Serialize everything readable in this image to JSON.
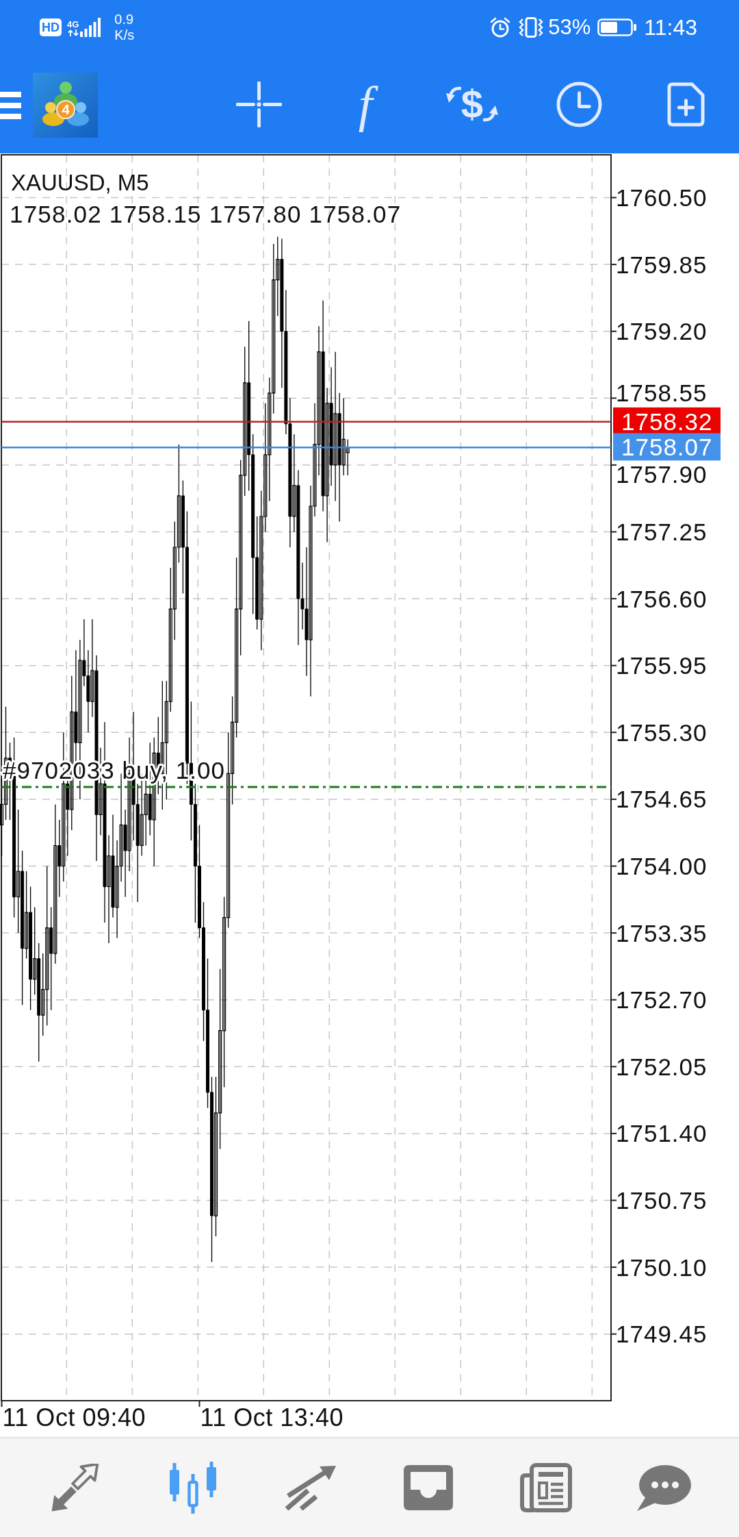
{
  "status_bar": {
    "network_badge": "HD",
    "network_type": "4G",
    "speed": "0.9",
    "speed_unit": "K/s",
    "battery": "53%",
    "time": "11:43"
  },
  "toolbar": {
    "logo_badge": "4",
    "buttons": [
      {
        "kind": "crosshair"
      },
      {
        "kind": "glyph",
        "text": "f"
      },
      {
        "kind": "money",
        "text": "$"
      },
      {
        "kind": "clock"
      },
      {
        "kind": "new-document"
      }
    ]
  },
  "chart": {
    "symbol": "XAUUSD, M5",
    "ohlc": "1758.02 1758.15 1757.80 1758.07",
    "order_label": "#9702033 buy, 1.00",
    "ask": "1758.32",
    "bid": "1758.07",
    "price_ticks": [
      "1760.50",
      "1759.85",
      "1759.20",
      "1758.55",
      "1757.90",
      "1757.25",
      "1756.60",
      "1755.95",
      "1755.30",
      "1754.65",
      "1754.00",
      "1753.35",
      "1752.70",
      "1752.05",
      "1751.40",
      "1750.75",
      "1750.10",
      "1749.45"
    ],
    "time_ticks": [
      "11 Oct 09:40",
      "11 Oct 13:40"
    ]
  },
  "bottom_nav": [
    {
      "kind": "quotes",
      "selected": false
    },
    {
      "kind": "chart",
      "selected": true
    },
    {
      "kind": "trade",
      "selected": false
    },
    {
      "kind": "history",
      "selected": false
    },
    {
      "kind": "news",
      "selected": false
    },
    {
      "kind": "chat",
      "selected": false
    }
  ]
}
